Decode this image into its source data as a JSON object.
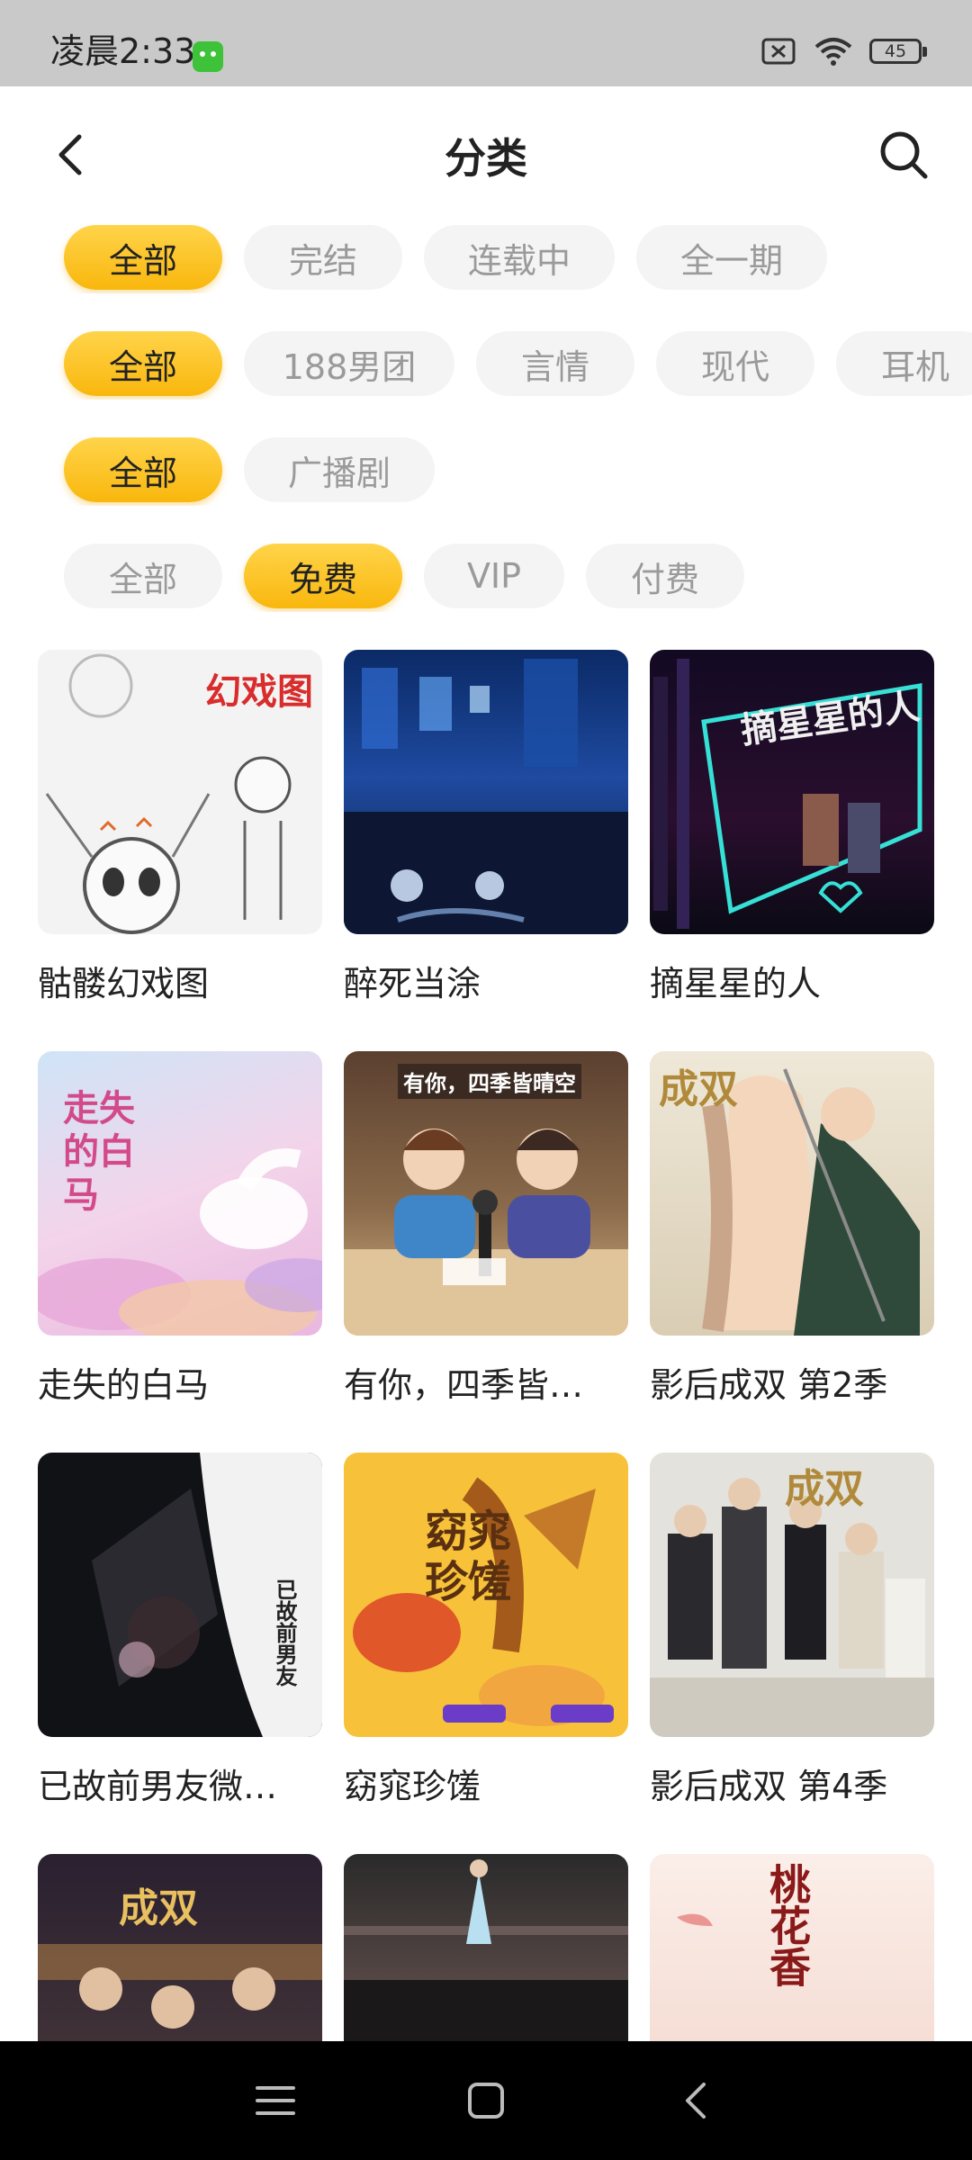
{
  "status_bar": {
    "time": "凌晨2:33",
    "battery": "45",
    "icons": [
      "app-notification-icon",
      "sim-off-icon",
      "wifi-icon",
      "battery-icon"
    ]
  },
  "header": {
    "title": "分类",
    "back_icon": "back-arrow-icon",
    "search_icon": "search-icon"
  },
  "filters": {
    "status": [
      "全部",
      "完结",
      "连载中",
      "全一期"
    ],
    "genre": [
      "全部",
      "188男团",
      "言情",
      "现代",
      "耳机"
    ],
    "type": [
      "全部",
      "广播剧"
    ],
    "price": [
      "全部",
      "免费",
      "VIP",
      "付费"
    ]
  },
  "selected": {
    "status": "全部",
    "genre": "全部",
    "type": "全部",
    "price": "免费"
  },
  "dramas": [
    {
      "title": "骷髅幻戏图",
      "cover_text": "幻戏图",
      "cover_color": "#f2f2f2"
    },
    {
      "title": "醉死当涂",
      "cover_text": "",
      "cover_color": "#1c3a7a"
    },
    {
      "title": "摘星星的人",
      "cover_text": "摘星星的人",
      "cover_color": "#1a0f2a"
    },
    {
      "title": "走失的白马",
      "cover_text": "走失的白马",
      "cover_color": "#e8c9e6"
    },
    {
      "title": "有你，四季皆…",
      "cover_text": "有你，四季皆晴空",
      "cover_color": "#7a5a3a"
    },
    {
      "title": "影后成双 第2季",
      "cover_text": "成双",
      "cover_color": "#e9e2d2"
    },
    {
      "title": "已故前男友微…",
      "cover_text": "已故前男友",
      "cover_color": "#141418"
    },
    {
      "title": "窈窕珍馐",
      "cover_text": "窈窕珍馐",
      "cover_color": "#f5c43a"
    },
    {
      "title": "影后成双 第4季",
      "cover_text": "成双",
      "cover_color": "#dcdcd6"
    },
    {
      "title": "",
      "cover_text": "成双",
      "cover_color": "#2a2530"
    },
    {
      "title": "",
      "cover_text": "",
      "cover_color": "#3a3636"
    },
    {
      "title": "",
      "cover_text": "桃花香",
      "cover_color": "#f7e3dc"
    }
  ],
  "nav_bar": {
    "icons": [
      "menu-icon",
      "home-icon",
      "back-icon"
    ]
  }
}
